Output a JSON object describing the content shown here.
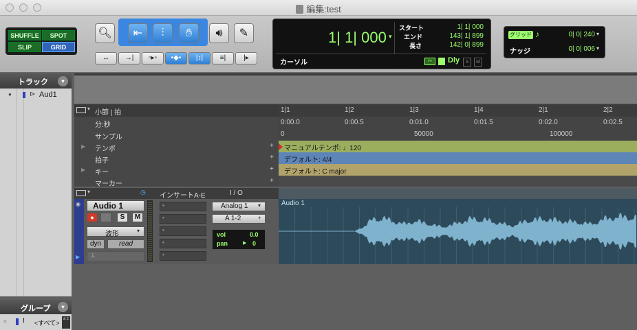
{
  "window": {
    "title": "編集:test"
  },
  "toolbar": {
    "modes": {
      "shuffle": "SHUFFLE",
      "spot": "SPOT",
      "slip": "SLIP",
      "grid": "GRID"
    },
    "tools": [
      "zoom",
      "trim",
      "select",
      "grab",
      "scrub",
      "pencil"
    ],
    "counter": {
      "main": "1| 1| 000",
      "cursor_label": "カーソル",
      "start_label": "スタート",
      "start_value": "1| 1| 000",
      "end_label": "エンド",
      "end_value": "143| 1| 899",
      "length_label": "長さ",
      "length_value": "142| 0| 899",
      "dly": "Dly"
    },
    "grid": {
      "label": "グリッド",
      "note_icon": "♪",
      "value": "0| 0| 240"
    },
    "nudge": {
      "label": "ナッジ",
      "value": "0| 0| 006"
    }
  },
  "tracks_panel": {
    "title": "トラック",
    "items": [
      {
        "name": "Aud1"
      }
    ]
  },
  "groups_panel": {
    "title": "グループ",
    "item": "<すべて>",
    "marker": "!",
    "az": "a z"
  },
  "rulers": {
    "bars_beats": "小節 | 拍",
    "min_sec": "分:秒",
    "samples": "サンプル",
    "tempo": "テンポ",
    "meter": "拍子",
    "key": "キー",
    "markers": "マーカー",
    "bar_ticks": [
      "1|1",
      "1|2",
      "1|3",
      "1|4",
      "2|1",
      "2|2"
    ],
    "min_ticks": [
      "0:00.0",
      "0:00.5",
      "0:01.0",
      "0:01.5",
      "0:02.0",
      "0:02.5"
    ],
    "sample_ticks": [
      "0",
      "50000",
      "100000"
    ],
    "tempo_text": "マニュアルテンポ: ♩120",
    "meter_text": "デフォルト: 4/4",
    "key_text": "デフォルト: C major",
    "add": "+"
  },
  "track": {
    "header_inserts": "インサートA-E",
    "header_io": "I / O",
    "name": "Audio 1",
    "rec": "●",
    "solo": "S",
    "mute": "M",
    "view": "波形",
    "dyn": "dyn",
    "automation": "read",
    "input": "Analog 1",
    "output": "A 1-2",
    "vol_label": "vol",
    "vol_value": "0.0",
    "pan_label": "pan",
    "pan_value": "0",
    "clip_name": "Audio 1"
  },
  "colors": {
    "tempo_ruler": "#9aae5e",
    "meter_ruler": "#5e85b8",
    "key_ruler": "#b1a36a",
    "clip_bg": "#2d4a5b",
    "waveform": "#7fb2cc"
  }
}
